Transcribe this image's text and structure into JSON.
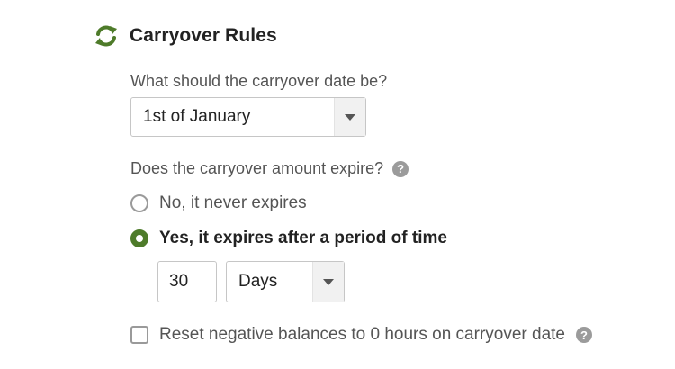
{
  "section": {
    "icon": "refresh-icon",
    "title": "Carryover Rules",
    "accent_color": "#4e7b2a"
  },
  "carryover_date": {
    "question": "What should the carryover date be?",
    "selected": "1st of January"
  },
  "expiry": {
    "question": "Does the carryover amount expire?",
    "help_icon": "question-circle-icon",
    "options": [
      {
        "label": "No, it never expires",
        "checked": false
      },
      {
        "label": "Yes, it expires after a period of time",
        "checked": true
      }
    ],
    "period_value": "30",
    "period_unit": "Days"
  },
  "reset_negative": {
    "label": "Reset negative balances to 0 hours on carryover date",
    "checked": false,
    "help_icon": "question-circle-icon"
  }
}
